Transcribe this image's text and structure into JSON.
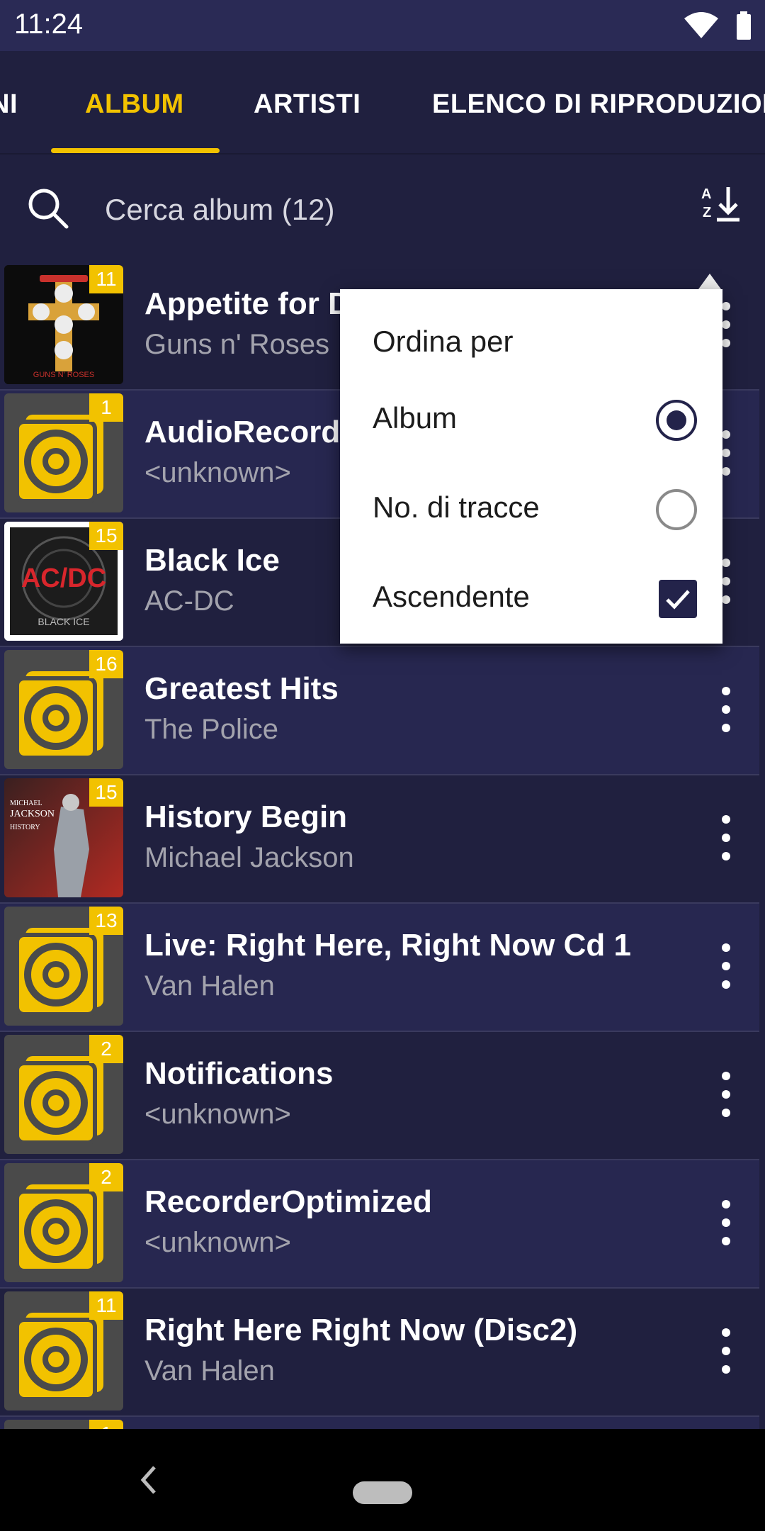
{
  "status_bar": {
    "time": "11:24"
  },
  "tabs": [
    {
      "label": "NI",
      "active": false
    },
    {
      "label": "ALBUM",
      "active": true
    },
    {
      "label": "ARTISTI",
      "active": false
    },
    {
      "label": "ELENCO DI RIPRODUZIONE",
      "active": false
    }
  ],
  "search": {
    "placeholder": "Cerca album (12)"
  },
  "sort_menu": {
    "header": "Ordina per",
    "options": [
      {
        "label": "Album",
        "control": "radio",
        "checked": true
      },
      {
        "label": "No. di tracce",
        "control": "radio",
        "checked": false
      },
      {
        "label": "Ascendente",
        "control": "checkbox",
        "checked": true
      }
    ]
  },
  "albums": [
    {
      "title": "Appetite for Destruction",
      "artist": "Guns n' Roses",
      "tracks": "11",
      "art": "gnr-cover"
    },
    {
      "title": "AudioRecorder",
      "artist": "<unknown>",
      "tracks": "1",
      "art": "default-album-icon"
    },
    {
      "title": "Black Ice",
      "artist": "AC-DC",
      "tracks": "15",
      "art": "acdc-cover"
    },
    {
      "title": "Greatest Hits",
      "artist": "The Police",
      "tracks": "16",
      "art": "default-album-icon"
    },
    {
      "title": "History Begin",
      "artist": "Michael Jackson",
      "tracks": "15",
      "art": "mj-cover"
    },
    {
      "title": "Live: Right Here, Right Now Cd 1",
      "artist": "Van Halen",
      "tracks": "13",
      "art": "default-album-icon"
    },
    {
      "title": "Notifications",
      "artist": "<unknown>",
      "tracks": "2",
      "art": "default-album-icon"
    },
    {
      "title": "RecorderOptimized",
      "artist": "<unknown>",
      "tracks": "2",
      "art": "default-album-icon"
    },
    {
      "title": "Right Here Right Now (Disc2)",
      "artist": "Van Halen",
      "tracks": "11",
      "art": "default-album-icon"
    },
    {
      "title": "",
      "artist": "",
      "tracks": "1",
      "art": "default-album-icon"
    }
  ],
  "cover_text": {
    "gnr": "GUNS N' ROSES",
    "acdc_logo": "AC/DC",
    "acdc_sub": "BLACK ICE",
    "mj_line1": "MICHAEL",
    "mj_line2": "JACKSON",
    "mj_line3": "HISTORY"
  },
  "colors": {
    "accent": "#f2c200",
    "background": "#20203f",
    "row_alt": "#272750",
    "status_bar": "#2a2a55",
    "popup": "#ffffff",
    "control": "#23234a"
  }
}
